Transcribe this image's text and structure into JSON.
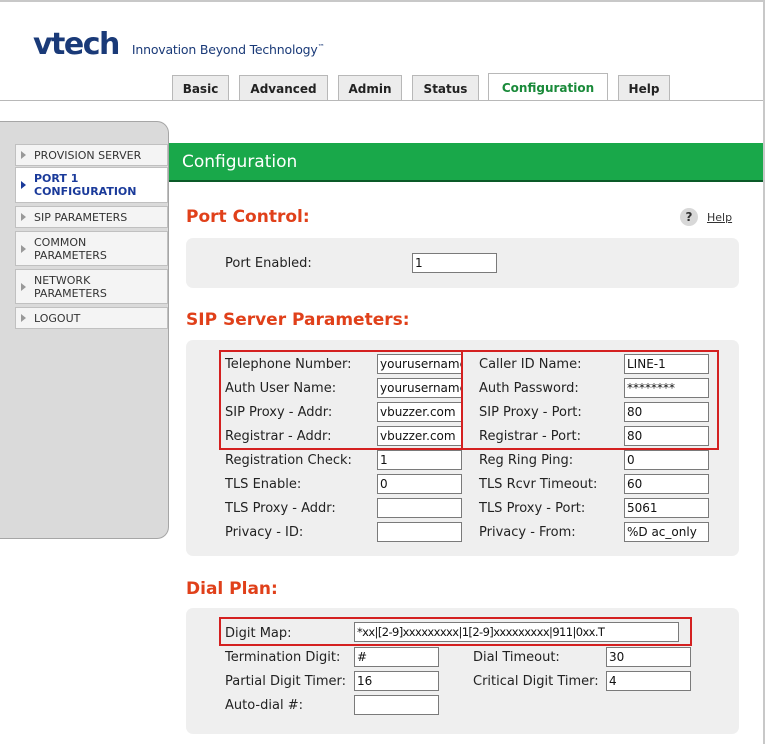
{
  "brand": {
    "logo": "vtech",
    "tagline": "Innovation Beyond Technology",
    "trademark": "™"
  },
  "tabs": [
    "Basic",
    "Advanced",
    "Admin",
    "Status",
    "Configuration",
    "Help"
  ],
  "active_tab": "Configuration",
  "sidebar": {
    "items": [
      {
        "label": "PROVISION SERVER"
      },
      {
        "label": "PORT 1 CONFIGURATION",
        "active": true
      },
      {
        "label": "SIP PARAMETERS"
      },
      {
        "label": "COMMON PARAMETERS"
      },
      {
        "label": "NETWORK PARAMETERS"
      },
      {
        "label": "LOGOUT"
      }
    ]
  },
  "page_title": "Configuration",
  "help": {
    "icon_glyph": "?",
    "label": "Help"
  },
  "port_control": {
    "title": "Port Control:",
    "port_enabled": {
      "label": "Port Enabled:",
      "value": "1"
    }
  },
  "sip_server": {
    "title": "SIP Server Parameters:",
    "left": [
      {
        "label": "Telephone Number:",
        "value": "yourusername"
      },
      {
        "label": "Auth User Name:",
        "value": "yourusername"
      },
      {
        "label": "SIP Proxy - Addr:",
        "value": "vbuzzer.com"
      },
      {
        "label": "Registrar - Addr:",
        "value": "vbuzzer.com"
      },
      {
        "label": "Registration Check:",
        "value": "1"
      },
      {
        "label": "TLS Enable:",
        "value": "0"
      },
      {
        "label": "TLS Proxy - Addr:",
        "value": ""
      },
      {
        "label": "Privacy - ID:",
        "value": ""
      }
    ],
    "right": [
      {
        "label": "Caller ID Name:",
        "value": "LINE-1"
      },
      {
        "label": "Auth Password:",
        "value": "********"
      },
      {
        "label": "SIP Proxy - Port:",
        "value": "80"
      },
      {
        "label": "Registrar - Port:",
        "value": "80"
      },
      {
        "label": "Reg Ring Ping:",
        "value": "0"
      },
      {
        "label": "TLS Rcvr Timeout:",
        "value": "60"
      },
      {
        "label": "TLS Proxy - Port:",
        "value": "5061"
      },
      {
        "label": "Privacy - From:",
        "value": "%D ac_only"
      }
    ]
  },
  "dial_plan": {
    "title": "Dial Plan:",
    "digit_map": {
      "label": "Digit Map:",
      "value": "*xx|[2-9]xxxxxxxxx|1[2-9]xxxxxxxxx|911|0xx.T"
    },
    "termination_digit": {
      "label": "Termination Digit:",
      "value": "#"
    },
    "dial_timeout": {
      "label": "Dial Timeout:",
      "value": "30"
    },
    "partial_digit_timer": {
      "label": "Partial Digit Timer:",
      "value": "16"
    },
    "critical_digit_timer": {
      "label": "Critical Digit Timer:",
      "value": "4"
    },
    "auto_dial": {
      "label": "Auto-dial #:",
      "value": ""
    }
  },
  "colors": {
    "brand_blue": "#1a3a78",
    "active_tab_green": "#1a8a3a",
    "header_bar_green": "#19a84a",
    "section_title_orange": "#e0401a",
    "highlight_red": "#d42020"
  }
}
